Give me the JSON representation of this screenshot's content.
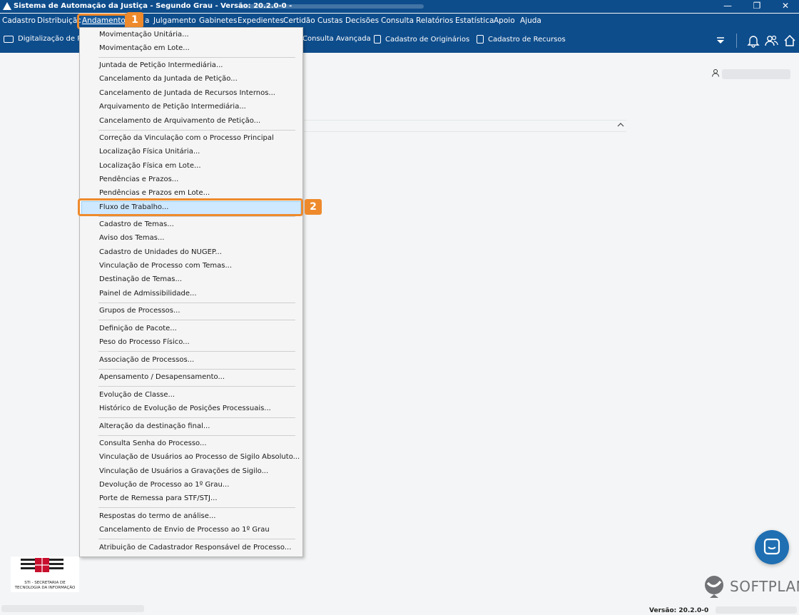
{
  "window": {
    "title": "Sistema de Automação da Justiça - Segundo Grau - Versão: 20.2.0-0 -",
    "minimize": "—",
    "restore": "❐",
    "close": "✕"
  },
  "menubar": {
    "items": [
      "Cadastro",
      "Distribuição",
      "Andamento",
      "a",
      "Julgamento",
      "Gabinetes",
      "Expedientes",
      "Certidão",
      "Custas",
      "Decisões",
      "Consulta",
      "Relatórios",
      "Estatística",
      "Apoio",
      "Ajuda"
    ]
  },
  "toolbar": {
    "items": [
      "Digitalização de Pe",
      "Consulta Avançada",
      "Cadastro de Originários",
      "Cadastro de Recursos"
    ],
    "icons": [
      "scanner-icon",
      "document-icon",
      "document-icon",
      "document-r-icon",
      "dropdown-icon",
      "bell-icon",
      "users-icon",
      "home-icon"
    ]
  },
  "dropdown": {
    "items": [
      "Movimentação Unitária...",
      "Movimentação em Lote...",
      "Juntada de Petição Intermediária...",
      "Cancelamento da Juntada de Petição...",
      "Cancelamento de Juntada de Recursos Internos...",
      "Arquivamento de Petição Intermediária...",
      "Cancelamento de Arquivamento de Petição...",
      "Correção da Vinculação com o Processo Principal",
      "Localização Física Unitária...",
      "Localização Física em Lote...",
      "Pendências e Prazos...",
      "Pendências e Prazos em Lote...",
      "Fluxo de Trabalho...",
      "Cadastro de Temas...",
      "Aviso dos Temas...",
      "Cadastro de Unidades do NUGEP...",
      "Vinculação de Processo com Temas...",
      "Destinação de Temas...",
      "Painel de Admissibilidade...",
      "Grupos de Processos...",
      "Definição de Pacote...",
      "Peso do Processo Físico...",
      "Associação de Processos...",
      "Apensamento / Desapensamento...",
      "Evolução de Classe...",
      "Histórico de Evolução de Posições Processuais...",
      "Alteração da destinação final...",
      "Consulta Senha do Processo...",
      "Vinculação de Usuários ao Processo de Sigilo Absoluto...",
      "Vinculação de Usuários a Gravações de Sigilo...",
      "Devolução de Processo ao 1º Grau...",
      "Porte de Remessa para STF/STJ...",
      "Respostas do termo de análise...",
      "Cancelamento de Envio de Processo ao 1º Grau",
      "Atribuição de Cadastrador Responsável de Processo..."
    ],
    "selected": "Fluxo de Trabalho..."
  },
  "annotations": {
    "badge1": "1",
    "badge2": "2"
  },
  "footer": {
    "logo_text_1": "STI - SECRETARIA DE",
    "logo_text_2": "TECNOLOGIA DA INFORMAÇÃO",
    "brand": "SOFTPLAN",
    "version": "Versão: 20.2.0-0"
  },
  "colors": {
    "header": "#0e4d8c",
    "accent": "#ee8a2c",
    "selection": "#cde8ff",
    "chat": "#1f6fb2"
  }
}
